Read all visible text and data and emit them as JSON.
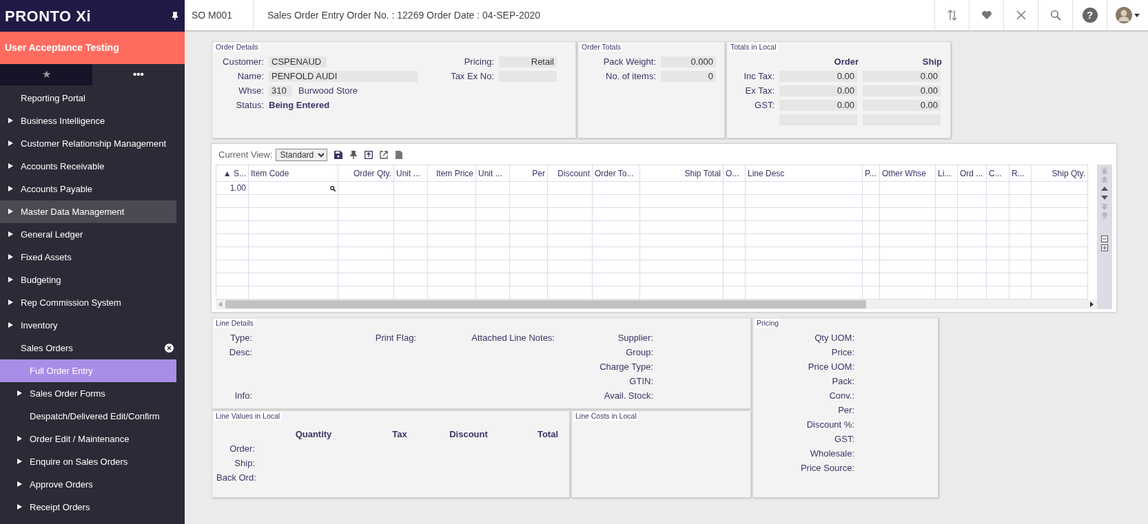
{
  "sidebar": {
    "logo": "PRONTO Xi",
    "environment": "User Acceptance Testing",
    "tabs": [
      {
        "label": "★",
        "selected": false
      },
      {
        "label": "•••",
        "selected": true
      }
    ],
    "items": [
      {
        "label": "Reporting Portal",
        "expandable": false,
        "selected": false,
        "highlighted": false
      },
      {
        "label": "Business Intelligence",
        "expandable": true,
        "selected": false,
        "highlighted": false
      },
      {
        "label": "Customer Relationship Management",
        "expandable": true,
        "selected": false,
        "highlighted": false
      },
      {
        "label": "Accounts Receivable",
        "expandable": true,
        "selected": false,
        "highlighted": false
      },
      {
        "label": "Accounts Payable",
        "expandable": true,
        "selected": false,
        "highlighted": false
      },
      {
        "label": "Master Data Management",
        "expandable": true,
        "selected": false,
        "highlighted": true
      },
      {
        "label": "General Ledger",
        "expandable": true,
        "selected": false,
        "highlighted": false
      },
      {
        "label": "Fixed Assets",
        "expandable": true,
        "selected": false,
        "highlighted": false
      },
      {
        "label": "Budgeting",
        "expandable": true,
        "selected": false,
        "highlighted": false
      },
      {
        "label": "Rep Commission System",
        "expandable": true,
        "selected": false,
        "highlighted": false
      },
      {
        "label": "Inventory",
        "expandable": true,
        "selected": false,
        "highlighted": false
      },
      {
        "label": "Sales Orders",
        "expandable": false,
        "selected": false,
        "highlighted": false,
        "children": [
          {
            "label": "Full Order Entry",
            "expandable": false,
            "selected": true,
            "highlighted": false
          },
          {
            "label": "Sales Order Forms",
            "expandable": true,
            "selected": false,
            "highlighted": false
          },
          {
            "label": "Despatch/Delivered Edit/Confirm",
            "expandable": false,
            "selected": false,
            "highlighted": false
          },
          {
            "label": "Order Edit / Maintenance",
            "expandable": true,
            "selected": false,
            "highlighted": false
          },
          {
            "label": "Enquire on Sales Orders",
            "expandable": true,
            "selected": false,
            "highlighted": false
          },
          {
            "label": "Approve Orders",
            "expandable": true,
            "selected": false,
            "highlighted": false
          },
          {
            "label": "Receipt Orders",
            "expandable": true,
            "selected": false,
            "highlighted": false
          }
        ]
      }
    ]
  },
  "header": {
    "code": "SO M001",
    "help": "?",
    "title": "Sales Order Entry Order No. : 12269 Order Date : 04-SEP-2020"
  },
  "order_details": {
    "title": "Order Details",
    "left": [
      {
        "label": "Customer:",
        "value": "CSPENAUD",
        "kind": "box"
      },
      {
        "label": "Name:",
        "value": "PENFOLD AUDI",
        "kind": "wide"
      },
      {
        "label": "Whse:",
        "value": "310",
        "extra": "Burwood Store",
        "kind": "box"
      },
      {
        "label": "Status:",
        "value": "Being Entered",
        "kind": "bold"
      }
    ],
    "right": [
      {
        "label": "Pricing:",
        "value": "Retail",
        "kind": "right"
      },
      {
        "label": "Tax Ex No:",
        "kind": "right"
      }
    ]
  },
  "order_totals": {
    "title": "Order Totals",
    "fields": [
      {
        "label": "Pack Weight:",
        "value": "0.000"
      },
      {
        "label": "No. of items:",
        "value": "0"
      }
    ]
  },
  "totals_in_local": {
    "title": "Totals in Local",
    "columns": [
      "Order",
      "Ship"
    ],
    "rows": [
      {
        "label": "Inc Tax:",
        "values": [
          "0.00",
          "0.00"
        ]
      },
      {
        "label": "Ex Tax:",
        "values": [
          "0.00",
          "0.00"
        ]
      },
      {
        "label": "GST:",
        "values": [
          "0.00",
          "0.00"
        ]
      },
      {
        "values": []
      }
    ]
  },
  "grid": {
    "view_label": "Current View:",
    "view": "Standard",
    "columns": [
      {
        "label": "▲ S...",
        "kind": "number"
      },
      {
        "label": "Item Code",
        "kind": "text"
      },
      {
        "label": "Order Qty.",
        "kind": "number"
      },
      {
        "label": "Unit ...",
        "kind": "text"
      },
      {
        "label": "Item Price",
        "kind": "number"
      },
      {
        "label": "Unit ...",
        "kind": "text"
      },
      {
        "label": "Per",
        "kind": "number"
      },
      {
        "label": "Discount",
        "kind": "number"
      },
      {
        "label": "Order To...",
        "kind": "text"
      },
      {
        "label": "Ship Total",
        "kind": "number"
      },
      {
        "label": "O...",
        "kind": "text"
      },
      {
        "label": "Line Desc",
        "kind": "text"
      },
      {
        "label": "P...",
        "kind": "text"
      },
      {
        "label": "Other Whse",
        "kind": "text"
      },
      {
        "label": "Li...",
        "kind": "text"
      },
      {
        "label": "Ord ...",
        "kind": "text"
      },
      {
        "label": "C...",
        "kind": "text"
      },
      {
        "label": "R...",
        "kind": "text"
      },
      {
        "label": "Ship Qty.",
        "kind": "number"
      }
    ],
    "rows": [
      {
        "sequence": "1.00",
        "lookup": true
      }
    ]
  },
  "line_details": {
    "title": "Line Details",
    "columns": [
      [
        "Type:",
        "Desc:",
        null,
        null,
        "Info:"
      ],
      [
        "Print Flag:"
      ],
      [
        "Attached Line Notes:"
      ],
      [
        "Supplier:",
        "Group:",
        "Charge Type:",
        "GTIN:",
        "Avail. Stock:"
      ]
    ]
  },
  "line_values": {
    "title": "Line Values in Local",
    "columns": [
      "Quantity",
      "Tax",
      "Discount",
      "Total"
    ],
    "rows": [
      "Order:",
      "Ship:",
      "Back Ord:"
    ]
  },
  "line_costs": {
    "title": "Line Costs in Local"
  },
  "pricing": {
    "title": "Pricing",
    "labels": [
      "Qty UOM:",
      "Price:",
      "Price UOM:",
      "Pack:",
      "Conv.:",
      "Per:",
      "Discount %:",
      "GST:",
      "Wholesale:",
      "Price Source:"
    ]
  }
}
